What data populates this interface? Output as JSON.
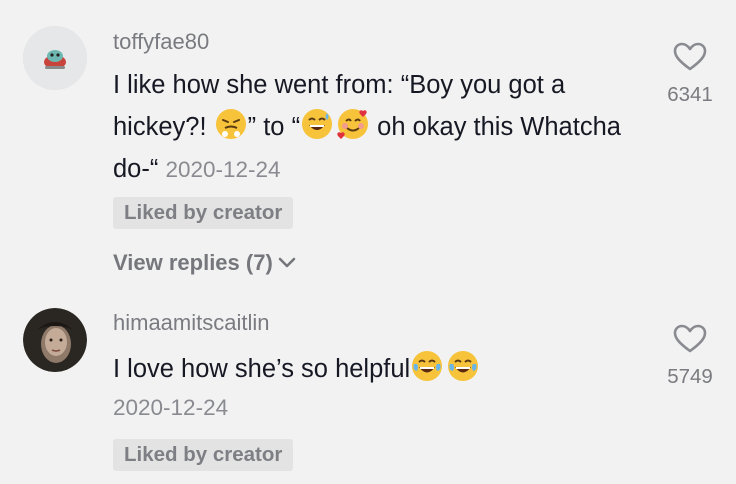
{
  "comments": [
    {
      "username": "toffyfae80",
      "text_part1": "I like how she went from: “Boy you got a hickey?! ",
      "text_part2": "” to “",
      "text_part3": " oh okay this Whatcha do-“ ",
      "emojis": [
        "huffing-face",
        "grinning-sweat-face",
        "smiling-face-with-hearts"
      ],
      "date": "2020-12-24",
      "liked_badge": "Liked by creator",
      "view_replies": "View replies (7)",
      "like_count": "6341"
    },
    {
      "username": "himaamitscaitlin",
      "text": "I love how she’s so helpful",
      "emojis": [
        "tears-of-joy-face",
        "tears-of-joy-face"
      ],
      "date": "2020-12-24",
      "liked_badge": "Liked by creator",
      "like_count": "5749"
    }
  ],
  "colors": {
    "background": "#f2f2f2",
    "text": "#161823",
    "muted": "#7a7b80",
    "badge_bg": "#e3e3e4"
  }
}
